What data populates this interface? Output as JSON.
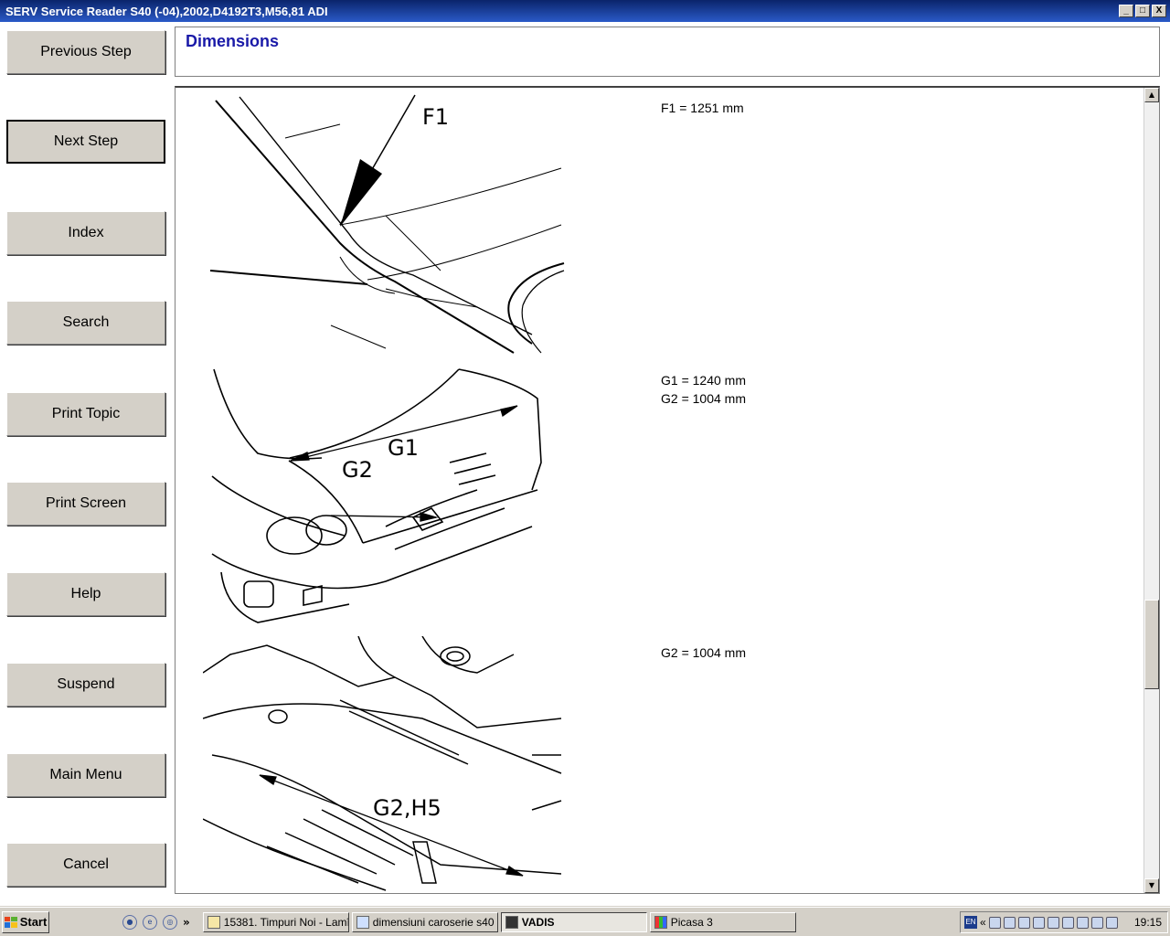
{
  "window": {
    "title": "SERV Service Reader S40 (-04),2002,D4192T3,M56,81 ADI",
    "minimize": "_",
    "maximize": "□",
    "close": "X"
  },
  "sidebar": {
    "buttons": [
      {
        "label": "Previous Step"
      },
      {
        "label": "Next Step"
      },
      {
        "label": "Index"
      },
      {
        "label": "Search"
      },
      {
        "label": "Print Topic"
      },
      {
        "label": "Print Screen"
      },
      {
        "label": "Help"
      },
      {
        "label": "Suspend"
      },
      {
        "label": "Main Menu"
      },
      {
        "label": "Cancel"
      }
    ]
  },
  "header": {
    "title": "Dimensions"
  },
  "content": {
    "figures": [
      {
        "callouts": [
          "F1"
        ],
        "dimensions": [
          "F1 = 1251 mm"
        ]
      },
      {
        "callouts": [
          "G1",
          "G2"
        ],
        "dimensions": [
          "G1 = 1240 mm",
          "G2 = 1004 mm"
        ]
      },
      {
        "callouts": [
          "G2,H5"
        ],
        "dimensions": [
          "G2 = 1004 mm"
        ]
      }
    ]
  },
  "taskbar": {
    "start_label": "Start",
    "quicklaunch_chevron": "»",
    "tasks": [
      {
        "label": "15381. Timpuri Noi - Lamî..."
      },
      {
        "label": "dimensiuni caroserie s40 ..."
      },
      {
        "label": "VADIS"
      },
      {
        "label": "Picasa 3"
      }
    ],
    "tray": {
      "lang": "EN",
      "chevron": "«",
      "clock": "19:15"
    }
  }
}
